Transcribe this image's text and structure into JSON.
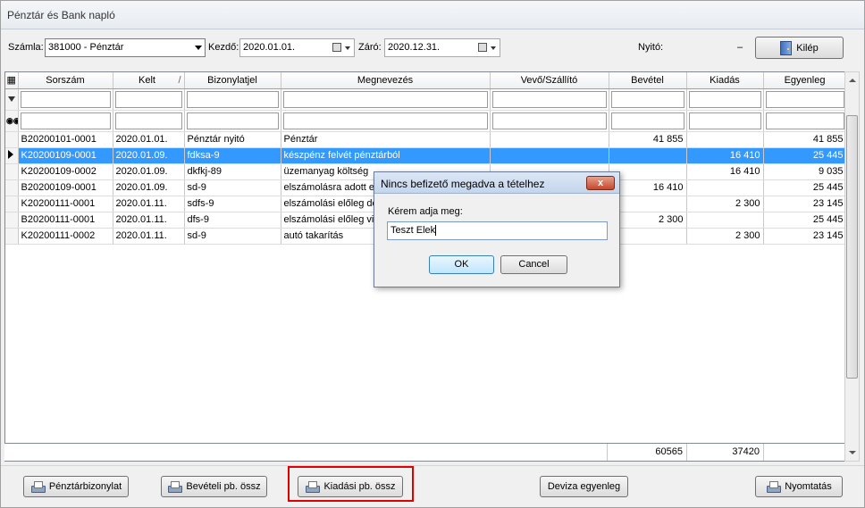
{
  "window": {
    "title": "Pénztár és Bank napló"
  },
  "toolbar": {
    "account_label": "Számla:",
    "account_value": "381000 - Pénztár",
    "start_label": "Kezdő:",
    "start_value": "2020.01.01.",
    "end_label": "Záró:",
    "end_value": "2020.12.31.",
    "opening_label": "Nyitó:",
    "opening_value": "–",
    "exit_label": "Kilép"
  },
  "grid": {
    "columns": [
      "Sorszám",
      "Kelt",
      "Bizonylatjel",
      "Megnevezés",
      "Vevő/Szállító",
      "Bevétel",
      "Kiadás",
      "Egyenleg"
    ],
    "sort_indicator": "/",
    "rows": [
      [
        "B20200101-0001",
        "2020.01.01.",
        "Pénztár nyitó",
        "Pénztár",
        "",
        "41 855",
        "",
        "41 855"
      ],
      [
        "K20200109-0001",
        "2020.01.09.",
        "fdksa-9",
        "készpénz felvét pénztárból",
        "",
        "",
        "16 410",
        "25 445"
      ],
      [
        "K20200109-0002",
        "2020.01.09.",
        "dkfkj-89",
        "üzemanyag költség",
        "",
        "",
        "16 410",
        "9 035"
      ],
      [
        "B20200109-0001",
        "2020.01.09.",
        "sd-9",
        "elszámolásra adott elő",
        "",
        "16 410",
        "",
        "25 445"
      ],
      [
        "K20200111-0001",
        "2020.01.11.",
        "sdfs-9",
        "elszámolási előleg dol",
        "",
        "",
        "2 300",
        "23 145"
      ],
      [
        "B20200111-0001",
        "2020.01.11.",
        "dfs-9",
        "elszámolási előleg vis",
        "",
        "2 300",
        "",
        "25 445"
      ],
      [
        "K20200111-0002",
        "2020.01.11.",
        "sd-9",
        "autó takarítás",
        "",
        "",
        "2 300",
        "23 145"
      ]
    ],
    "selected_row": 1,
    "totals": {
      "income": "60565",
      "expense": "37420"
    }
  },
  "bottom": {
    "btn1": "Pénztárbizonylat",
    "btn2": "Bevételi pb. össz",
    "btn3": "Kiadási pb. össz",
    "btn4": "Deviza egyenleg",
    "btn5": "Nyomtatás"
  },
  "dialog": {
    "title": "Nincs befizető megadva a tételhez",
    "close": "x",
    "prompt": "Kérem adja meg:",
    "value": "Teszt Elek",
    "ok": "OK",
    "cancel": "Cancel"
  },
  "colors": {
    "selection": "#3399ff",
    "highlight_border": "#e00000"
  },
  "icons": [
    "printer-icon",
    "exit-door-icon",
    "calendar-icon",
    "filter-icon",
    "binoculars-icon",
    "row-pointer-icon"
  ]
}
